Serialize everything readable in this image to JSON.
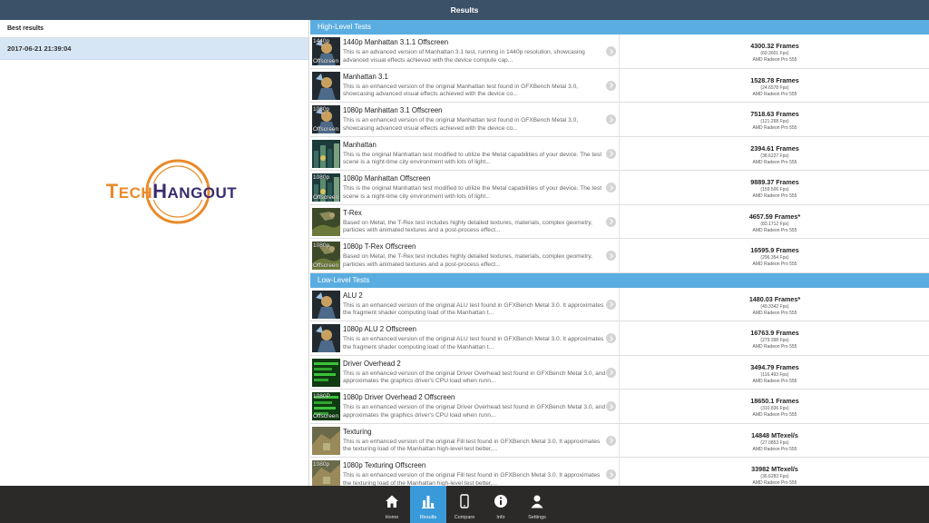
{
  "header": {
    "title": "Results"
  },
  "left": {
    "header": "Best results",
    "items": [
      {
        "label": "2017-06-21 21:39:04"
      }
    ],
    "logo": {
      "text": "TECHHANGOUT"
    }
  },
  "sections": [
    {
      "title": "High-Level Tests",
      "rows": [
        {
          "name": "1440p Manhattan 3.1.1 Offscreen",
          "desc": "This is an advanced version of Manhattan 3.1 test, running in 1440p resolution, showcasing advanced visual effects achieved with the device compute cap...",
          "score": "4300.32 Frames",
          "fps": "(69.3601 Fps)",
          "gpu": "AMD Radeon Pro 555",
          "thumb": {
            "top": "1440p",
            "bottom": "Offscreen",
            "style": "hero"
          }
        },
        {
          "name": "Manhattan 3.1",
          "desc": "This is an enhanced version of the original Manhattan test found in GFXBench Metal 3.0, showcasing advanced visual effects achieved with the device co...",
          "score": "1528.78 Frames",
          "fps": "(24.6578 Fps)",
          "gpu": "AMD Radeon Pro 555",
          "thumb": {
            "top": "",
            "bottom": "",
            "style": "hero"
          }
        },
        {
          "name": "1080p Manhattan 3.1 Offscreen",
          "desc": "This is an enhanced version of the original Manhattan test found in GFXBench Metal 3.0, showcasing advanced visual effects achieved with the device co...",
          "score": "7518.63 Frames",
          "fps": "(121.268 Fps)",
          "gpu": "AMD Radeon Pro 555",
          "thumb": {
            "top": "1080p",
            "bottom": "Offscreen",
            "style": "hero"
          }
        },
        {
          "name": "Manhattan",
          "desc": "This is the original Manhattan test modified to utilize the Metal capabilities of your device. The test scene is a night-time city environment with lots of light...",
          "score": "2394.61 Frames",
          "fps": "(38.6227 Fps)",
          "gpu": "AMD Radeon Pro 555",
          "thumb": {
            "top": "",
            "bottom": "",
            "style": "city"
          }
        },
        {
          "name": "1080p Manhattan Offscreen",
          "desc": "This is the original Manhattan test modified to utilize the Metal capabilities of your device. The test scene is a night-time city environment with lots of light...",
          "score": "9889.37 Frames",
          "fps": "(159.506 Fps)",
          "gpu": "AMD Radeon Pro 555",
          "thumb": {
            "top": "1080p",
            "bottom": "Offscreen",
            "style": "city"
          }
        },
        {
          "name": "T-Rex",
          "desc": "Based on Metal, the T-Rex test includes highly detailed textures, materials, complex geometry, particles with animated textures and a post-process effect...",
          "score": "4657.59 Frames*",
          "fps": "(83.1712 Fps)",
          "gpu": "AMD Radeon Pro 555",
          "thumb": {
            "top": "",
            "bottom": "",
            "style": "trex"
          }
        },
        {
          "name": "1080p T-Rex Offscreen",
          "desc": "Based on Metal, the T-Rex test includes highly detailed textures, materials, complex geometry, particles with animated textures and a post-process effect...",
          "score": "16595.9 Frames",
          "fps": "(296.354 Fps)",
          "gpu": "AMD Radeon Pro 555",
          "thumb": {
            "top": "1080p",
            "bottom": "Offscreen",
            "style": "trex"
          }
        }
      ]
    },
    {
      "title": "Low-Level Tests",
      "rows": [
        {
          "name": "ALU 2",
          "desc": "This is an enhanced version of the original ALU test found in GFXBench Metal 3.0. It approximates the fragment shader computing load of the Manhattan t...",
          "score": "1480.03 Frames*",
          "fps": "(49.3342 Fps)",
          "gpu": "AMD Radeon Pro 555",
          "thumb": {
            "top": "",
            "bottom": "",
            "style": "hero"
          }
        },
        {
          "name": "1080p ALU 2 Offscreen",
          "desc": "This is an enhanced version of the original ALU test found in GFXBench Metal 3.0. It approximates the fragment shader computing load of the Manhattan t...",
          "score": "16763.9 Frames",
          "fps": "(279.398 Fps)",
          "gpu": "AMD Radeon Pro 555",
          "thumb": {
            "top": "",
            "bottom": "",
            "style": "hero"
          }
        },
        {
          "name": "Driver Overhead 2",
          "desc": "This is an enhanced version of the original Driver Overhead test found in GFXBench Metal 3.0, and approximates the graphics driver's CPU load when runn...",
          "score": "3494.79 Frames",
          "fps": "(116.493 Fps)",
          "gpu": "AMD Radeon Pro 555",
          "thumb": {
            "top": "",
            "bottom": "",
            "style": "driver"
          }
        },
        {
          "name": "1080p Driver Overhead 2 Offscreen",
          "desc": "This is an enhanced version of the original Driver Overhead test found in GFXBench Metal 3.0, and approximates the graphics driver's CPU load when runn...",
          "score": "18650.1 Frames",
          "fps": "(310.836 Fps)",
          "gpu": "AMD Radeon Pro 555",
          "thumb": {
            "top": "1080P",
            "bottom": "Offscreen",
            "style": "driver"
          }
        },
        {
          "name": "Texturing",
          "desc": "This is an enhanced version of the original Fill test found in GFXBench Metal 3.0. It approximates the texturing load of the Manhattan high-level test better,...",
          "score": "14848 MTexel/s",
          "fps": "(27.0853 Fps)",
          "gpu": "AMD Radeon Pro 555",
          "thumb": {
            "top": "",
            "bottom": "",
            "style": "texture"
          }
        },
        {
          "name": "1080p Texturing Offscreen",
          "desc": "This is an enhanced version of the original Fill test found in GFXBench Metal 3.0. It approximates the texturing load of the Manhattan high-level test better,...",
          "score": "33982 MTexel/s",
          "fps": "(36.6283 Fps)",
          "gpu": "AMD Radeon Pro 555",
          "thumb": {
            "top": "1080p",
            "bottom": "",
            "style": "texture"
          }
        }
      ]
    }
  ],
  "tabs": [
    {
      "label": "Home",
      "icon": "home-icon",
      "active": false
    },
    {
      "label": "Results",
      "icon": "results-icon",
      "active": true
    },
    {
      "label": "Compare",
      "icon": "compare-icon",
      "active": false
    },
    {
      "label": "Info",
      "icon": "info-icon",
      "active": false
    },
    {
      "label": "Settings",
      "icon": "settings-icon",
      "active": false
    }
  ],
  "colors": {
    "topbar": "#3b5168",
    "section_header": "#5aade0",
    "selected_row": "#d6e6f5",
    "tabbar": "#2c2a29",
    "active_tab": "#3a9ad9",
    "logo_orange": "#e88a2a",
    "logo_purple": "#3a2c6e"
  }
}
